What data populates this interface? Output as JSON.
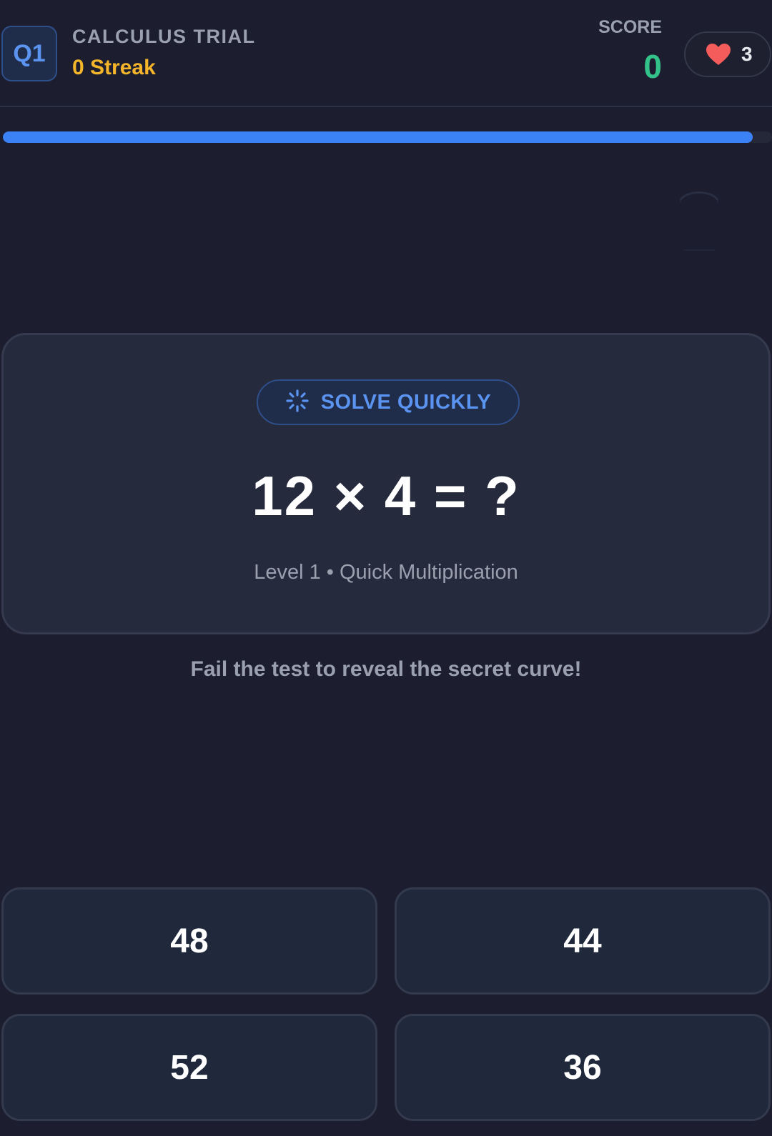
{
  "header": {
    "question_badge": "Q1",
    "title": "CALCULUS TRIAL",
    "streak": "0 Streak",
    "score_label": "SCORE",
    "score_value": "0",
    "lives_icon": "heart-icon",
    "lives": "3"
  },
  "progress": {
    "fraction": 0.975,
    "color": "#3b82f6"
  },
  "question": {
    "hint_icon": "loading-spinner-icon",
    "hint_label": "SOLVE QUICKLY",
    "equation": "12 × 4 = ?",
    "level_text": "Level 1 • Quick Multiplication"
  },
  "hint_text": "Fail the test to reveal the secret curve!",
  "answers": [
    {
      "label": "48"
    },
    {
      "label": "44"
    },
    {
      "label": "52"
    },
    {
      "label": "36"
    }
  ],
  "colors": {
    "background": "#1c1d2e",
    "accent_blue": "#3b82f6",
    "streak_yellow": "#f5b52b",
    "score_green": "#33c28a",
    "heart_red": "#f45c5c"
  }
}
